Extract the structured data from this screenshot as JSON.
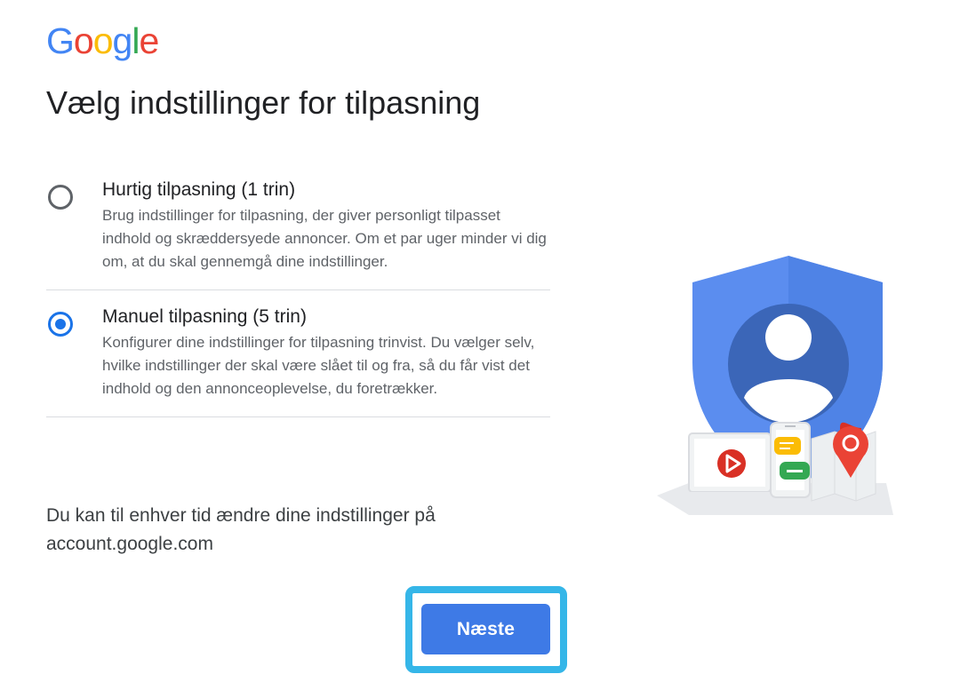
{
  "logo": {
    "letters": [
      "G",
      "o",
      "o",
      "g",
      "l",
      "e"
    ],
    "colors": [
      "#4285F4",
      "#EA4335",
      "#FBBC05",
      "#4285F4",
      "#34A853",
      "#EA4335"
    ]
  },
  "page_title": "Vælg indstillinger for tilpasning",
  "options": [
    {
      "title": "Hurtig tilpasning (1 trin)",
      "description": "Brug indstillinger for tilpasning, der giver personligt tilpasset indhold og skræddersyede annoncer. Om et par uger minder vi dig om, at du skal gennemgå dine indstillinger.",
      "selected": false
    },
    {
      "title": "Manuel tilpasning (5 trin)",
      "description": "Konfigurer dine indstillinger for tilpasning trinvist. Du vælger selv, hvilke indstillinger der skal være slået til og fra, så du får vist det indhold og den annonceoplevelse, du foretrækker.",
      "selected": true
    }
  ],
  "footer_note": "Du kan til enhver tid ændre dine indstillinger på account.google.com",
  "next_button": {
    "label": "Næste"
  },
  "colors": {
    "accent": "#1a73e8",
    "button": "#3e7ae6",
    "focus_ring": "#35b6e8"
  },
  "illustration": {
    "icons": [
      "shield-icon",
      "person-icon",
      "play-icon",
      "chat-icon",
      "map-pin-icon"
    ]
  }
}
